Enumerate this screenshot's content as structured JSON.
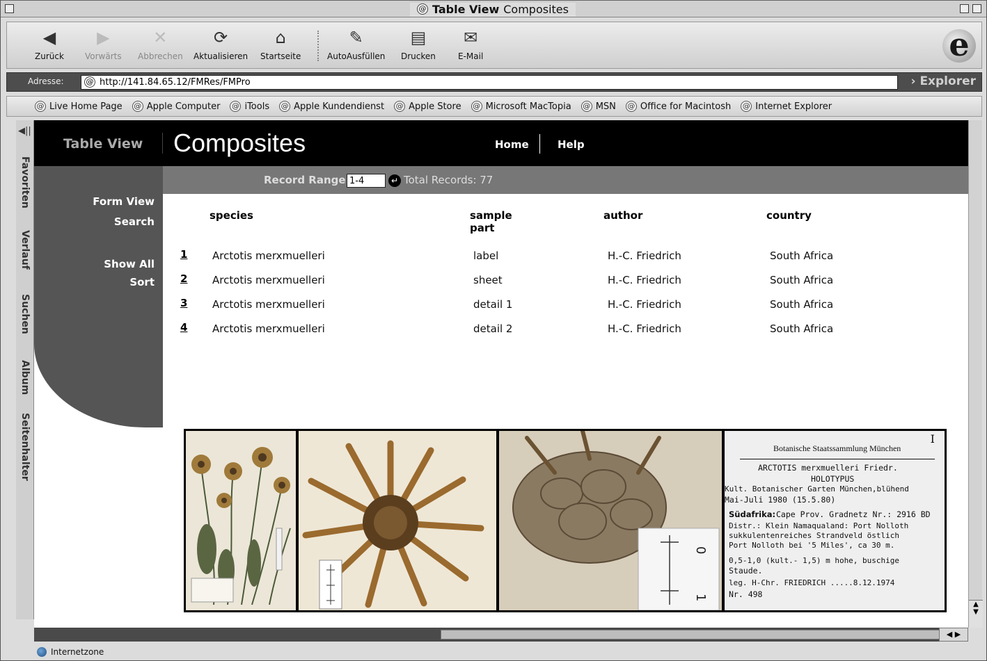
{
  "window": {
    "title_bold": "Table View",
    "title_rest": "Composites"
  },
  "toolbar": {
    "buttons": [
      {
        "label": "Zurück",
        "icon": "back-arrow-icon"
      },
      {
        "label": "Vorwärts",
        "icon": "forward-arrow-icon"
      },
      {
        "label": "Abbrechen",
        "icon": "stop-icon"
      },
      {
        "label": "Aktualisieren",
        "icon": "refresh-icon"
      },
      {
        "label": "Startseite",
        "icon": "home-icon"
      },
      {
        "label": "AutoAusfüllen",
        "icon": "autofill-icon"
      },
      {
        "label": "Drucken",
        "icon": "print-icon"
      },
      {
        "label": "E-Mail",
        "icon": "mail-icon"
      }
    ]
  },
  "address": {
    "label": "Adresse:",
    "url": "http://141.84.65.12/FMRes/FMPro",
    "explorer_label": "Explorer"
  },
  "favorites": [
    "Live Home Page",
    "Apple Computer",
    "iTools",
    "Apple Kundendienst",
    "Apple Store",
    "Microsoft MacTopia",
    "MSN",
    "Office for Macintosh",
    "Internet Explorer"
  ],
  "side_tabs": [
    "Favoriten",
    "Verlauf",
    "Suchen",
    "Album",
    "Seitenhalter"
  ],
  "page": {
    "section_label": "Table View",
    "title": "Composites",
    "nav": {
      "home": "Home",
      "help": "Help"
    },
    "left_links": {
      "form_view": "Form View",
      "search": "Search",
      "show_all": "Show All",
      "sort": "Sort"
    },
    "record_range_label": "Record Range",
    "record_range_value": "1-4",
    "total_records": "Total Records: 77",
    "columns": [
      "species",
      "sample part",
      "author",
      "country"
    ],
    "rows": [
      {
        "num": "1",
        "species": "Arctotis merxmuelleri",
        "part": "label",
        "author": "H.-C. Friedrich",
        "country": "South Africa"
      },
      {
        "num": "2",
        "species": "Arctotis merxmuelleri",
        "part": "sheet",
        "author": "H.-C. Friedrich",
        "country": "South Africa"
      },
      {
        "num": "3",
        "species": "Arctotis merxmuelleri",
        "part": "detail 1",
        "author": "H.-C. Friedrich",
        "country": "South Africa"
      },
      {
        "num": "4",
        "species": "Arctotis merxmuelleri",
        "part": "detail 2",
        "author": "H.-C. Friedrich",
        "country": "South Africa"
      }
    ]
  },
  "specimen_label": {
    "institution": "Botanische Staatssammlung München",
    "mark": "I",
    "lines": [
      "ARCTOTIS merxmuelleri Friedr.",
      "HOLOTYPUS",
      "Kult. Botanischer Garten München,blühend",
      "Mai-Juli 1980 (15.5.80)",
      "Südafrika:",
      "Cape Prov. Gradnetz Nr.: 2916 BD",
      "Distr.: Klein Namaqualand: Port Nolloth",
      "sukkulentenreiches Strandveld östlich",
      "Port Nolloth bei '5 Miles', ca 30 m.",
      "0,5-1,0 (kult.- 1,5) m hohe, buschige",
      "Staude.",
      "leg. H-Chr. FRIEDRICH   .....8.12.1974",
      "Nr. 498"
    ]
  },
  "status": {
    "zone": "Internetzone"
  }
}
